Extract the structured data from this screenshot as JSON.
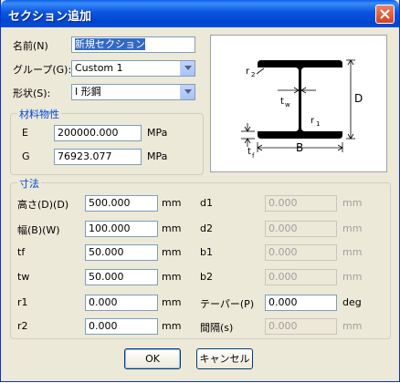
{
  "window": {
    "title": "セクション追加"
  },
  "name_label": "名前(N)",
  "name_value": "新規セクション",
  "group_label": "グループ(G):",
  "group_value": "Custom 1",
  "shape_label": "形状(S):",
  "shape_value": "I 形鋼",
  "material": {
    "title": "材料物性",
    "e_label": "E",
    "e_value": "200000.000",
    "e_unit": "MPa",
    "g_label": "G",
    "g_value": "76923.077",
    "g_unit": "MPa"
  },
  "diagram": {
    "label_r2": "r",
    "label_r2_sub": "2",
    "label_tw": "t",
    "label_tw_sub": "w",
    "label_r1": "r",
    "label_r1_sub": "1",
    "label_D": "D",
    "label_tf": "t",
    "label_tf_sub": "f",
    "label_B": "B"
  },
  "dimensions": {
    "title": "寸法",
    "rows_left": [
      {
        "label": "高さ(D)(D)",
        "value": "500.000",
        "unit": "mm"
      },
      {
        "label": "幅(B)(W)",
        "value": "100.000",
        "unit": "mm"
      },
      {
        "label": "tf",
        "value": "50.000",
        "unit": "mm"
      },
      {
        "label": "tw",
        "value": "50.000",
        "unit": "mm"
      },
      {
        "label": "r1",
        "value": "0.000",
        "unit": "mm"
      },
      {
        "label": "r2",
        "value": "0.000",
        "unit": "mm"
      }
    ],
    "rows_right": [
      {
        "label": "d1",
        "value": "0.000",
        "unit": "mm"
      },
      {
        "label": "d2",
        "value": "0.000",
        "unit": "mm"
      },
      {
        "label": "b1",
        "value": "0.000",
        "unit": "mm"
      },
      {
        "label": "b2",
        "value": "0.000",
        "unit": "mm"
      },
      {
        "label": "テーパー(P)",
        "value": "0.000",
        "unit": "deg"
      },
      {
        "label": "間隔(s)",
        "value": "0.000",
        "unit": "mm"
      }
    ]
  },
  "buttons": {
    "ok": "OK",
    "cancel": "キャンセル"
  }
}
